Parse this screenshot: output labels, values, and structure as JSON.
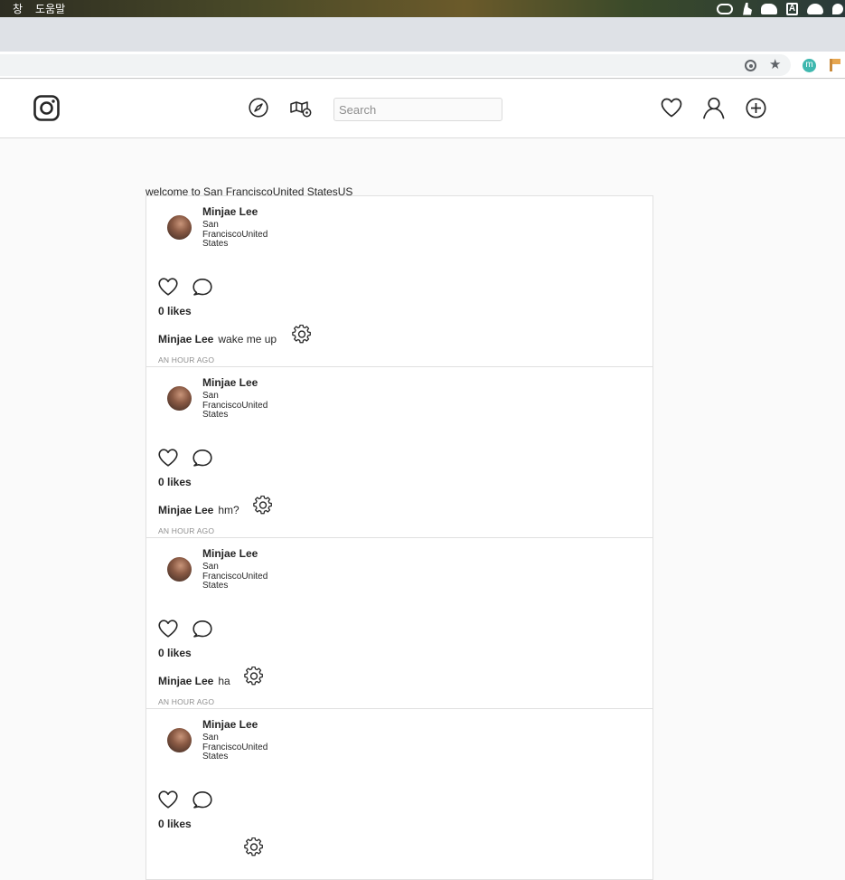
{
  "menubar": {
    "items": [
      "창",
      "도움말"
    ]
  },
  "header": {
    "search_placeholder": "Search"
  },
  "welcome_text": "welcome to San FranciscoUnited StatesUS",
  "posts": [
    {
      "username": "Minjae Lee",
      "location": "San FranciscoUnited States",
      "likes": "0 likes",
      "caption_user": "Minjae Lee",
      "caption_text": "wake me up",
      "time": "AN HOUR AGO"
    },
    {
      "username": "Minjae Lee",
      "location": "San FranciscoUnited States",
      "likes": "0 likes",
      "caption_user": "Minjae Lee",
      "caption_text": "hm?",
      "time": "AN HOUR AGO"
    },
    {
      "username": "Minjae Lee",
      "location": "San FranciscoUnited States",
      "likes": "0 likes",
      "caption_user": "Minjae Lee",
      "caption_text": "ha",
      "time": "AN HOUR AGO"
    },
    {
      "username": "Minjae Lee",
      "location": "San FranciscoUnited States",
      "likes": "0 likes",
      "caption_user": "Minjae Lee",
      "caption_text": "",
      "time": ""
    }
  ],
  "colors": {
    "border": "#dbdbdb",
    "text": "#262626",
    "muted": "#8e8e8e"
  }
}
